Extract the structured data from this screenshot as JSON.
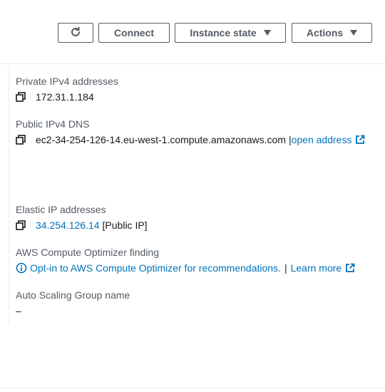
{
  "toolbar": {
    "refresh_icon": "refresh-icon",
    "connect_label": "Connect",
    "instance_state_label": "Instance state",
    "actions_label": "Actions"
  },
  "details": {
    "private_ipv4": {
      "label": "Private IPv4 addresses",
      "value": "172.31.1.184"
    },
    "public_dns": {
      "label": "Public IPv4 DNS",
      "value": "ec2-34-254-126-14.eu-west-1.compute.amazonaws.com",
      "separator": "|",
      "link_label": "open address"
    },
    "elastic_ip": {
      "label": "Elastic IP addresses",
      "link_value": "34.254.126.14",
      "suffix": "[Public IP]"
    },
    "compute_optimizer": {
      "label": "AWS Compute Optimizer finding",
      "message": "Opt-in to AWS Compute Optimizer for recommendations.",
      "separator": "|",
      "learn_more_label": "Learn more"
    },
    "auto_scaling": {
      "label": "Auto Scaling Group name",
      "value": "–"
    }
  },
  "colors": {
    "link": "#0073bb",
    "label": "#545b64",
    "text": "#16191f",
    "border": "#545b64"
  }
}
